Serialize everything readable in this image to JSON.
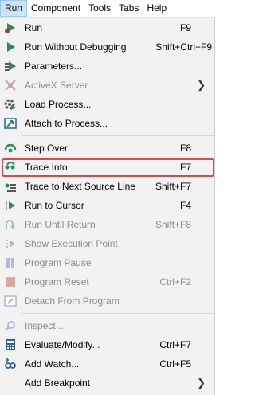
{
  "menubar": {
    "items": [
      {
        "label": "Run"
      },
      {
        "label": "Component"
      },
      {
        "label": "Tools"
      },
      {
        "label": "Tabs"
      },
      {
        "label": "Help"
      }
    ]
  },
  "menu": {
    "items": [
      {
        "label": "Run",
        "shortcut": "F9",
        "icon": "run-icon"
      },
      {
        "label": "Run Without Debugging",
        "shortcut": "Shift+Ctrl+F9",
        "icon": "run-without-debugging-icon"
      },
      {
        "label": "Parameters...",
        "shortcut": "",
        "icon": "parameters-icon"
      },
      {
        "label": "ActiveX Server",
        "shortcut": "",
        "icon": "activex-server-icon"
      },
      {
        "label": "Load Process...",
        "shortcut": "",
        "icon": "load-process-icon"
      },
      {
        "label": "Attach to Process...",
        "shortcut": "",
        "icon": "attach-process-icon"
      },
      {
        "label": "Step Over",
        "shortcut": "F8",
        "icon": "step-over-icon"
      },
      {
        "label": "Trace Into",
        "shortcut": "F7",
        "icon": "trace-into-icon"
      },
      {
        "label": "Trace to Next Source Line",
        "shortcut": "Shift+F7",
        "icon": "trace-next-line-icon"
      },
      {
        "label": "Run to Cursor",
        "shortcut": "F4",
        "icon": "run-to-cursor-icon"
      },
      {
        "label": "Run Until Return",
        "shortcut": "Shift+F8",
        "icon": "run-until-return-icon"
      },
      {
        "label": "Show Execution Point",
        "shortcut": "",
        "icon": "show-execution-point-icon"
      },
      {
        "label": "Program Pause",
        "shortcut": "",
        "icon": "pause-icon"
      },
      {
        "label": "Program Reset",
        "shortcut": "Ctrl+F2",
        "icon": "reset-icon"
      },
      {
        "label": "Detach From Program",
        "shortcut": "",
        "icon": "detach-icon"
      },
      {
        "label": "Inspect...",
        "shortcut": "",
        "icon": "inspect-icon"
      },
      {
        "label": "Evaluate/Modify...",
        "shortcut": "Ctrl+F7",
        "icon": "evaluate-icon"
      },
      {
        "label": "Add Watch...",
        "shortcut": "Ctrl+F5",
        "icon": "add-watch-icon"
      },
      {
        "label": "Add Breakpoint",
        "shortcut": "",
        "icon": "add-breakpoint-icon"
      }
    ]
  },
  "colors": {
    "highlight_border": "#e0474c",
    "accent_green": "#2e8b57",
    "disabled_text": "#8d8d8d"
  }
}
